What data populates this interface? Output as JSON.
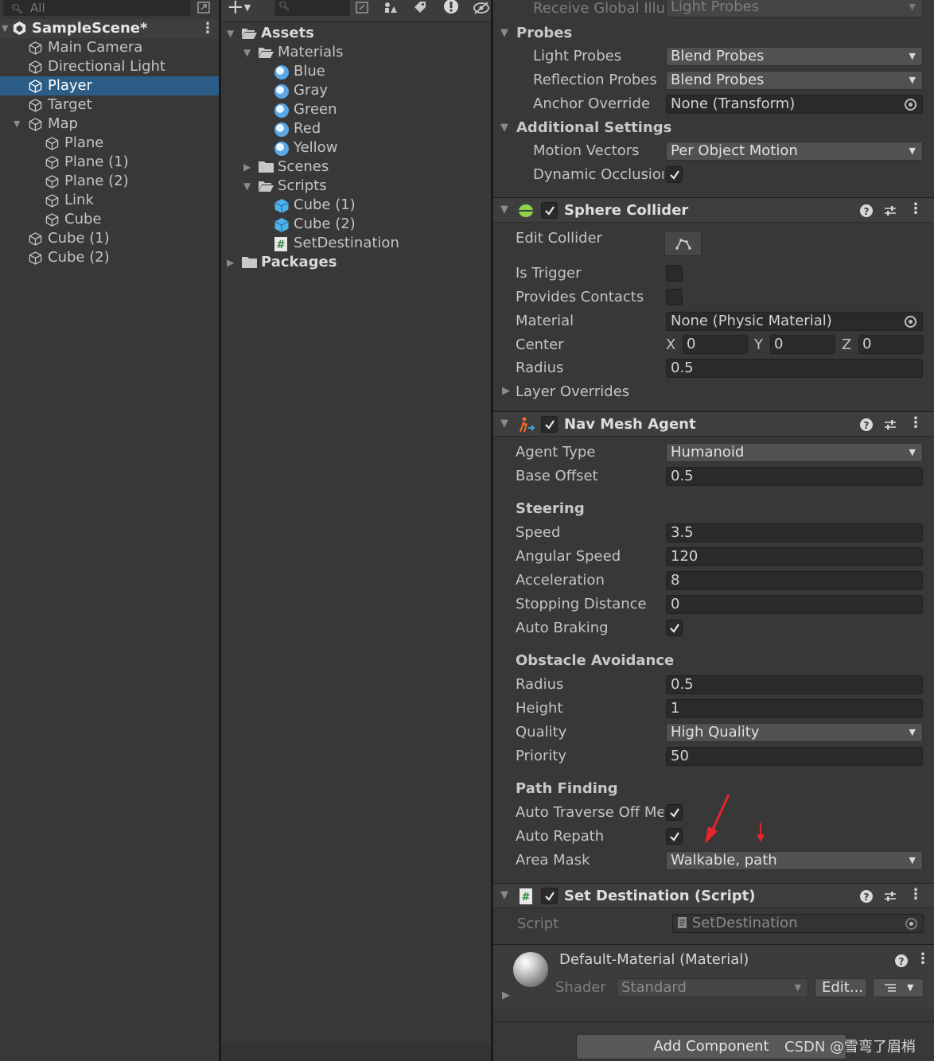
{
  "hierarchy": {
    "search_placeholder": "All",
    "scene": "SampleScene*",
    "items": [
      {
        "label": "Main Camera"
      },
      {
        "label": "Directional Light"
      },
      {
        "label": "Player"
      },
      {
        "label": "Target"
      },
      {
        "label": "Map"
      },
      {
        "label": "Plane"
      },
      {
        "label": "Plane (1)"
      },
      {
        "label": "Plane (2)"
      },
      {
        "label": "Link"
      },
      {
        "label": "Cube"
      },
      {
        "label": "Cube (1)"
      },
      {
        "label": "Cube (2)"
      }
    ]
  },
  "project": {
    "assets": "Assets",
    "materials": "Materials",
    "material_items": [
      "Blue",
      "Gray",
      "Green",
      "Red",
      "Yellow"
    ],
    "scenes": "Scenes",
    "scripts": "Scripts",
    "script_items": [
      "Cube (1)",
      "Cube (2)",
      "SetDestination"
    ],
    "packages": "Packages"
  },
  "inspector": {
    "receive_gi_label": "Receive Global Illu",
    "receive_gi_value": "Light Probes",
    "probes": {
      "title": "Probes",
      "light_probes_label": "Light Probes",
      "light_probes_value": "Blend Probes",
      "reflection_probes_label": "Reflection Probes",
      "reflection_probes_value": "Blend Probes",
      "anchor_override_label": "Anchor Override",
      "anchor_override_value": "None (Transform)"
    },
    "additional": {
      "title": "Additional Settings",
      "motion_vectors_label": "Motion Vectors",
      "motion_vectors_value": "Per Object Motion",
      "dynamic_occlusion_label": "Dynamic Occlusion"
    },
    "sphere_collider": {
      "title": "Sphere Collider",
      "edit_collider_label": "Edit Collider",
      "is_trigger_label": "Is Trigger",
      "provides_contacts_label": "Provides Contacts",
      "material_label": "Material",
      "material_value": "None (Physic Material)",
      "center_label": "Center",
      "center_x_label": "X",
      "center_x": "0",
      "center_y_label": "Y",
      "center_y": "0",
      "center_z_label": "Z",
      "center_z": "0",
      "radius_label": "Radius",
      "radius_value": "0.5",
      "layer_overrides_label": "Layer Overrides"
    },
    "nav_mesh_agent": {
      "title": "Nav Mesh Agent",
      "agent_type_label": "Agent Type",
      "agent_type_value": "Humanoid",
      "base_offset_label": "Base Offset",
      "base_offset_value": "0.5",
      "steering_title": "Steering",
      "speed_label": "Speed",
      "speed_value": "3.5",
      "angular_speed_label": "Angular Speed",
      "angular_speed_value": "120",
      "acceleration_label": "Acceleration",
      "acceleration_value": "8",
      "stopping_distance_label": "Stopping Distance",
      "stopping_distance_value": "0",
      "auto_braking_label": "Auto Braking",
      "obstacle_title": "Obstacle Avoidance",
      "radius_label": "Radius",
      "radius_value": "0.5",
      "height_label": "Height",
      "height_value": "1",
      "quality_label": "Quality",
      "quality_value": "High Quality",
      "priority_label": "Priority",
      "priority_value": "50",
      "path_title": "Path Finding",
      "auto_traverse_label": "Auto Traverse Off Me",
      "auto_repath_label": "Auto Repath",
      "area_mask_label": "Area Mask",
      "area_mask_value": "Walkable, path"
    },
    "set_destination": {
      "title": "Set Destination (Script)",
      "script_label": "Script",
      "script_value": "SetDestination"
    },
    "material": {
      "title": "Default-Material (Material)",
      "shader_label": "Shader",
      "shader_value": "Standard",
      "edit_label": "Edit..."
    },
    "add_component_label": "Add Component"
  },
  "watermark": "CSDN @雪弯了眉梢",
  "colors": {
    "selection": "#2c5d87",
    "annotation_arrow": "#e8242a"
  }
}
